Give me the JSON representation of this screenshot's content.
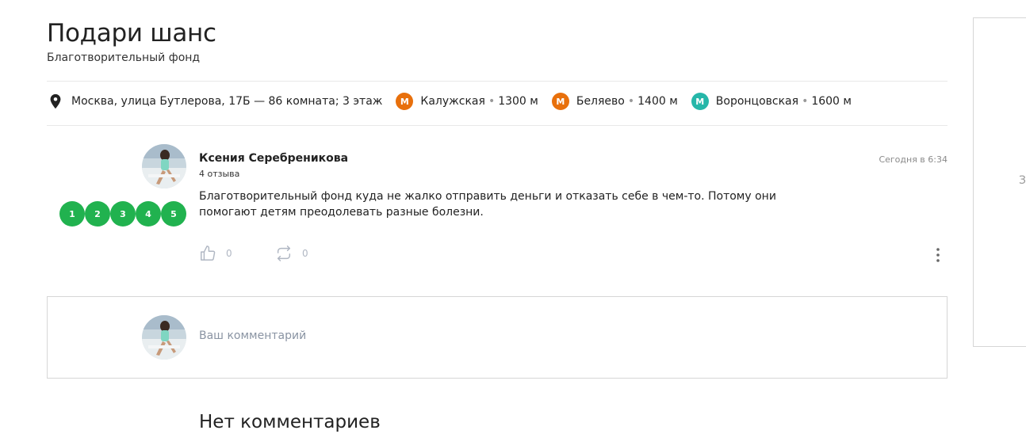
{
  "org": {
    "title": "Подари шанс",
    "subtitle": "Благотворительный фонд"
  },
  "address": {
    "icon": "location-pin-icon",
    "text": "Москва, улица Бутлерова, 17Б — 86 комната; 3 этаж",
    "metro": [
      {
        "letter": "М",
        "name": "Калужская",
        "distance": "1300 м",
        "color": "#e8700c"
      },
      {
        "letter": "М",
        "name": "Беляево",
        "distance": "1400 м",
        "color": "#e8700c"
      },
      {
        "letter": "М",
        "name": "Воронцовская",
        "distance": "1600 м",
        "color": "#26b7a9"
      }
    ]
  },
  "review": {
    "author": "Ксения Серебреникова",
    "reviews_count": "4 отзыва",
    "date": "Сегодня в 6:34",
    "text": "Благотворительный фонд куда не жалко отправить деньги и отказать себе в чем-то. Потому они помогают детям преодолевать разные болезни.",
    "rating_options": [
      "1",
      "2",
      "3",
      "4",
      "5"
    ],
    "rating_color": "#21b24f",
    "likes": "0",
    "shares": "0"
  },
  "comment": {
    "placeholder": "Ваш комментарий"
  },
  "comments_status": "Нет комментариев",
  "side_card": {
    "fragment": "З"
  }
}
